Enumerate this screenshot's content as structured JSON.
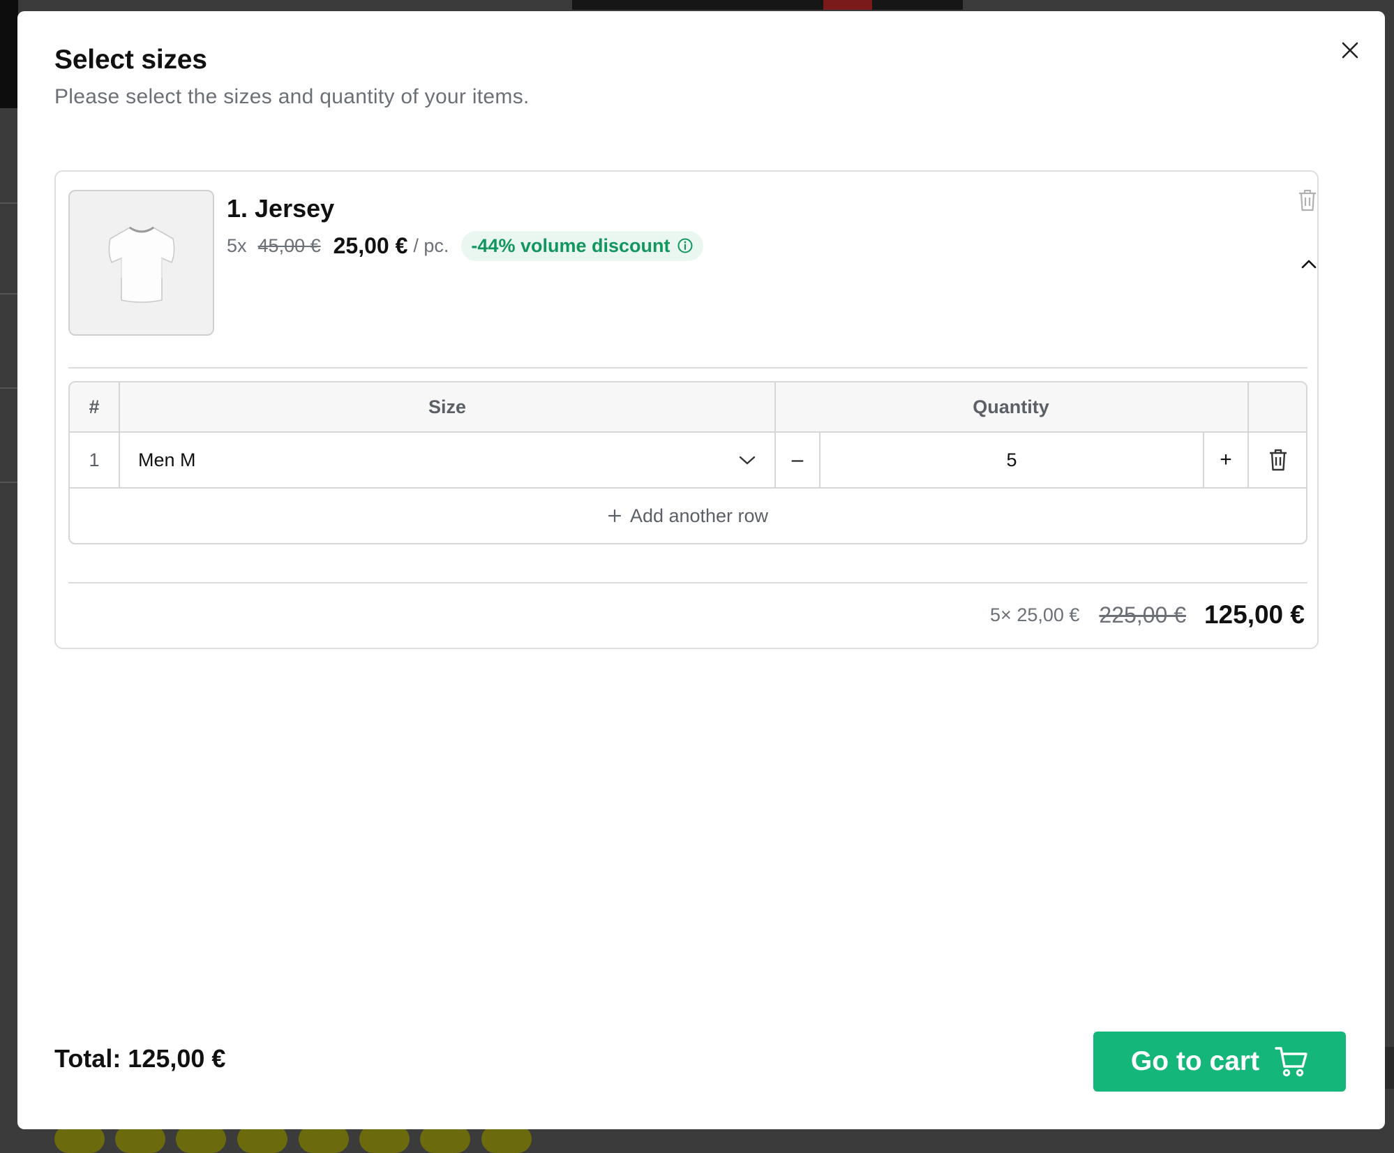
{
  "modal": {
    "title": "Select sizes",
    "subtitle": "Please select the sizes and quantity of your items."
  },
  "item": {
    "name": "1. Jersey",
    "quantity_prefix": "5x",
    "old_unit_price": "45,00 €",
    "unit_price": "25,00 €",
    "per_unit": "/ pc.",
    "discount_badge": "-44% volume discount",
    "image_icon": "t-shirt-icon"
  },
  "table": {
    "headers": {
      "number": "#",
      "size": "Size",
      "quantity": "Quantity"
    },
    "rows": [
      {
        "number": "1",
        "size": "Men M",
        "quantity": "5"
      }
    ],
    "add_row_label": "Add another row",
    "decrement_label": "–",
    "increment_label": "+"
  },
  "summary": {
    "calc": "5× 25,00 €",
    "old_total": "225,00 €",
    "total": "125,00 €"
  },
  "footer": {
    "total_label": "Total: 125,00 €",
    "cart_button": "Go to cart"
  },
  "colors": {
    "accent": "#15b67a",
    "discount_text": "#12955f",
    "discount_bg": "#eaf7f1",
    "muted_text": "#6b6f76"
  }
}
